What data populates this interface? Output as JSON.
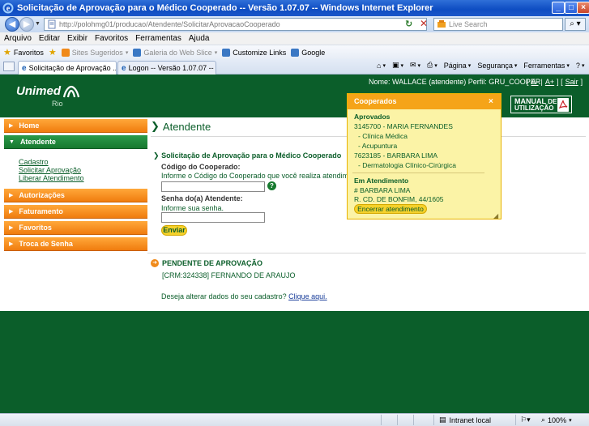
{
  "window": {
    "title": "Solicitação de Aprovação para o Médico Cooperado -- Versão 1.07.07 -- Windows Internet Explorer",
    "address": "http://polohmg01/producao/Atendente/SolicitarAprovacaoCooperado",
    "search_placeholder": "Live Search"
  },
  "menu": [
    "Arquivo",
    "Editar",
    "Exibir",
    "Favoritos",
    "Ferramentas",
    "Ajuda"
  ],
  "favorites_bar": {
    "favorites": "Favoritos",
    "sites": "Sites Sugeridos",
    "webslice": "Galeria do Web Slice",
    "customize": "Customize Links",
    "google": "Google"
  },
  "tabs": [
    {
      "label": "Solicitação de Aprovação ..."
    },
    {
      "label": "Logon -- Versão 1.07.07 --"
    }
  ],
  "command_bar": {
    "page": "Página",
    "security": "Segurança",
    "tools": "Ferramentas"
  },
  "header": {
    "logo": "Unimed",
    "logo_sub": "Rio",
    "user_info": "Nome: WALLACE (atendente) Perfil: GRU_COOPER",
    "font_smaller": "A-",
    "font_larger": "A+",
    "logout": "Sair",
    "manual_line1": "MANUAL",
    "manual_de": "DE",
    "manual_line2": "UTILIZAÇÃO"
  },
  "sidebar": {
    "items": [
      {
        "label": "Home"
      },
      {
        "label": "Atendente"
      },
      {
        "label": "Autorizações"
      },
      {
        "label": "Faturamento"
      },
      {
        "label": "Favoritos"
      },
      {
        "label": "Troca de Senha"
      }
    ],
    "submenu": [
      "Cadastro",
      "Solicitar Aprovação",
      "Liberar Atendimento"
    ]
  },
  "main": {
    "title": "Atendente",
    "form_heading": "Solicitação de Aprovação para o Médico Cooperado",
    "cod_label": "Código do Cooperado:",
    "cod_hint": "Informe o Código do Cooperado que você realiza atendimento.",
    "cod_value": "",
    "senha_label": "Senha do(a) Atendente:",
    "senha_hint": "Informe sua senha.",
    "senha_value": "",
    "submit": "Enviar",
    "pending_title": "PENDENTE DE APROVAÇÃO",
    "pending_item": "[CRM:324338]  FERNANDO DE ARAUJO",
    "update_text": "Deseja alterar dados do seu cadastro?",
    "update_link": "Clique aqui."
  },
  "popup": {
    "title": "Cooperados",
    "approved_heading": "Aprovados",
    "approved": [
      {
        "name": "3145700 - MARIA FERNANDES",
        "specialties": [
          "- Clínica Médica",
          "- Acupuntura"
        ]
      },
      {
        "name": "7623185 - BARBARA LIMA",
        "specialties": [
          "- Dermatologia Clínico-Cirúrgica"
        ]
      }
    ],
    "attending_heading": "Em Atendimento",
    "attending_name": "# BARBARA  LIMA",
    "attending_address": "R. CD. DE BONFIM, 44/1605",
    "end_button": "Encerrar atendimento"
  },
  "statusbar": {
    "zone": "Intranet local",
    "zoom": "100%"
  },
  "colors": {
    "brand_green": "#0b5e2a",
    "accent_orange": "#f07c0e",
    "popup_yellow": "#fbf3a6"
  }
}
